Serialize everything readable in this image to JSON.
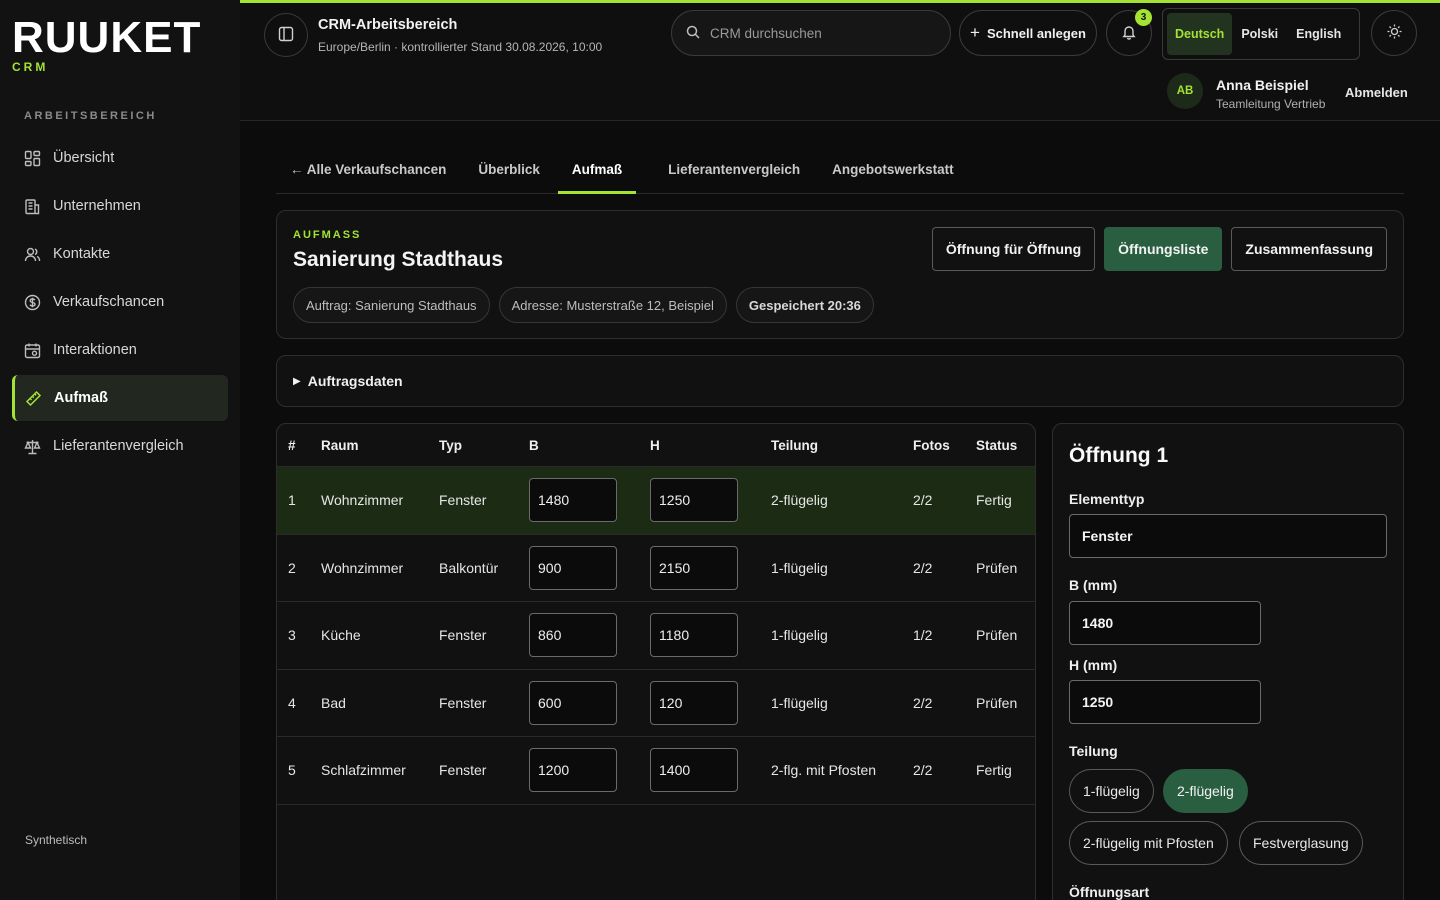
{
  "brand": {
    "name": "RUUKET",
    "sub": "CRM"
  },
  "sidebar": {
    "section": "ARBEITSBEREICH",
    "items": [
      {
        "label": "Übersicht",
        "icon": "grid-icon"
      },
      {
        "label": "Unternehmen",
        "icon": "building-icon"
      },
      {
        "label": "Kontakte",
        "icon": "users-icon"
      },
      {
        "label": "Verkaufschancen",
        "icon": "dollar-circle-icon"
      },
      {
        "label": "Interaktionen",
        "icon": "calendar-icon"
      },
      {
        "label": "Aufmaß",
        "icon": "ruler-icon",
        "active": true
      },
      {
        "label": "Lieferantenvergleich",
        "icon": "scale-icon"
      }
    ],
    "footer": "Synthetisch"
  },
  "topbar": {
    "title": "CRM-Arbeitsbereich",
    "subtitle": "Europe/Berlin · kontrollierter Stand 30.08.2026, 10:00",
    "search_placeholder": "CRM durchsuchen",
    "quick_create": "Schnell anlegen",
    "notifications": "3",
    "languages": [
      "Deutsch",
      "Polski",
      "English"
    ],
    "active_language": "Deutsch",
    "user": {
      "initials": "AB",
      "name": "Anna Beispiel",
      "role": "Teamleitung Vertrieb"
    },
    "logout": "Abmelden"
  },
  "tabs": [
    "← Alle Verkaufschancen",
    "Überblick",
    "Aufmaß",
    "Lieferantenvergleich",
    "Angebotswerkstatt"
  ],
  "active_tab": "Aufmaß",
  "header": {
    "eyebrow": "AUFMASS",
    "title": "Sanierung Stadthaus",
    "chips": [
      "Auftrag: Sanierung Stadthaus",
      "Adresse: Musterstraße 12, Beispiel",
      "Gespeichert 20:36"
    ],
    "views": [
      "Öffnung für Öffnung",
      "Öffnungsliste",
      "Zusammenfassung"
    ],
    "active_view": "Öffnungsliste"
  },
  "accordion": {
    "label": "Auftragsdaten"
  },
  "table": {
    "columns": [
      "#",
      "Raum",
      "Typ",
      "B",
      "H",
      "Teilung",
      "Fotos",
      "Status"
    ],
    "rows": [
      {
        "num": "1",
        "raum": "Wohnzimmer",
        "typ": "Fenster",
        "b": "1480",
        "h": "1250",
        "teilung": "2-flügelig",
        "fotos": "2/2",
        "status": "Fertig"
      },
      {
        "num": "2",
        "raum": "Wohnzimmer",
        "typ": "Balkontür",
        "b": "900",
        "h": "2150",
        "teilung": "1-flügelig",
        "fotos": "2/2",
        "status": "Prüfen"
      },
      {
        "num": "3",
        "raum": "Küche",
        "typ": "Fenster",
        "b": "860",
        "h": "1180",
        "teilung": "1-flügelig",
        "fotos": "1/2",
        "status": "Prüfen"
      },
      {
        "num": "4",
        "raum": "Bad",
        "typ": "Fenster",
        "b": "600",
        "h": "120",
        "teilung": "1-flügelig",
        "fotos": "2/2",
        "status": "Prüfen"
      },
      {
        "num": "5",
        "raum": "Schlafzimmer",
        "typ": "Fenster",
        "b": "1200",
        "h": "1400",
        "teilung": "2-flg. mit Pfosten",
        "fotos": "2/2",
        "status": "Fertig"
      }
    ],
    "selected_row": "1"
  },
  "detail": {
    "title": "Öffnung 1",
    "element_label": "Elementtyp",
    "element_value": "Fenster",
    "b_label": "B (mm)",
    "b_value": "1480",
    "h_label": "H (mm)",
    "h_value": "1250",
    "teilung_label": "Teilung",
    "teilung_options": [
      "1-flügelig",
      "2-flügelig",
      "2-flügelig mit Pfosten",
      "Festverglasung"
    ],
    "teilung_active": "2-flügelig",
    "oeffnungsart_label": "Öffnungsart"
  },
  "colors": {
    "accent": "#a4e234",
    "active_button": "#2a5e40",
    "selected_row": "#1c2b14",
    "background": "#0c0c0c"
  }
}
